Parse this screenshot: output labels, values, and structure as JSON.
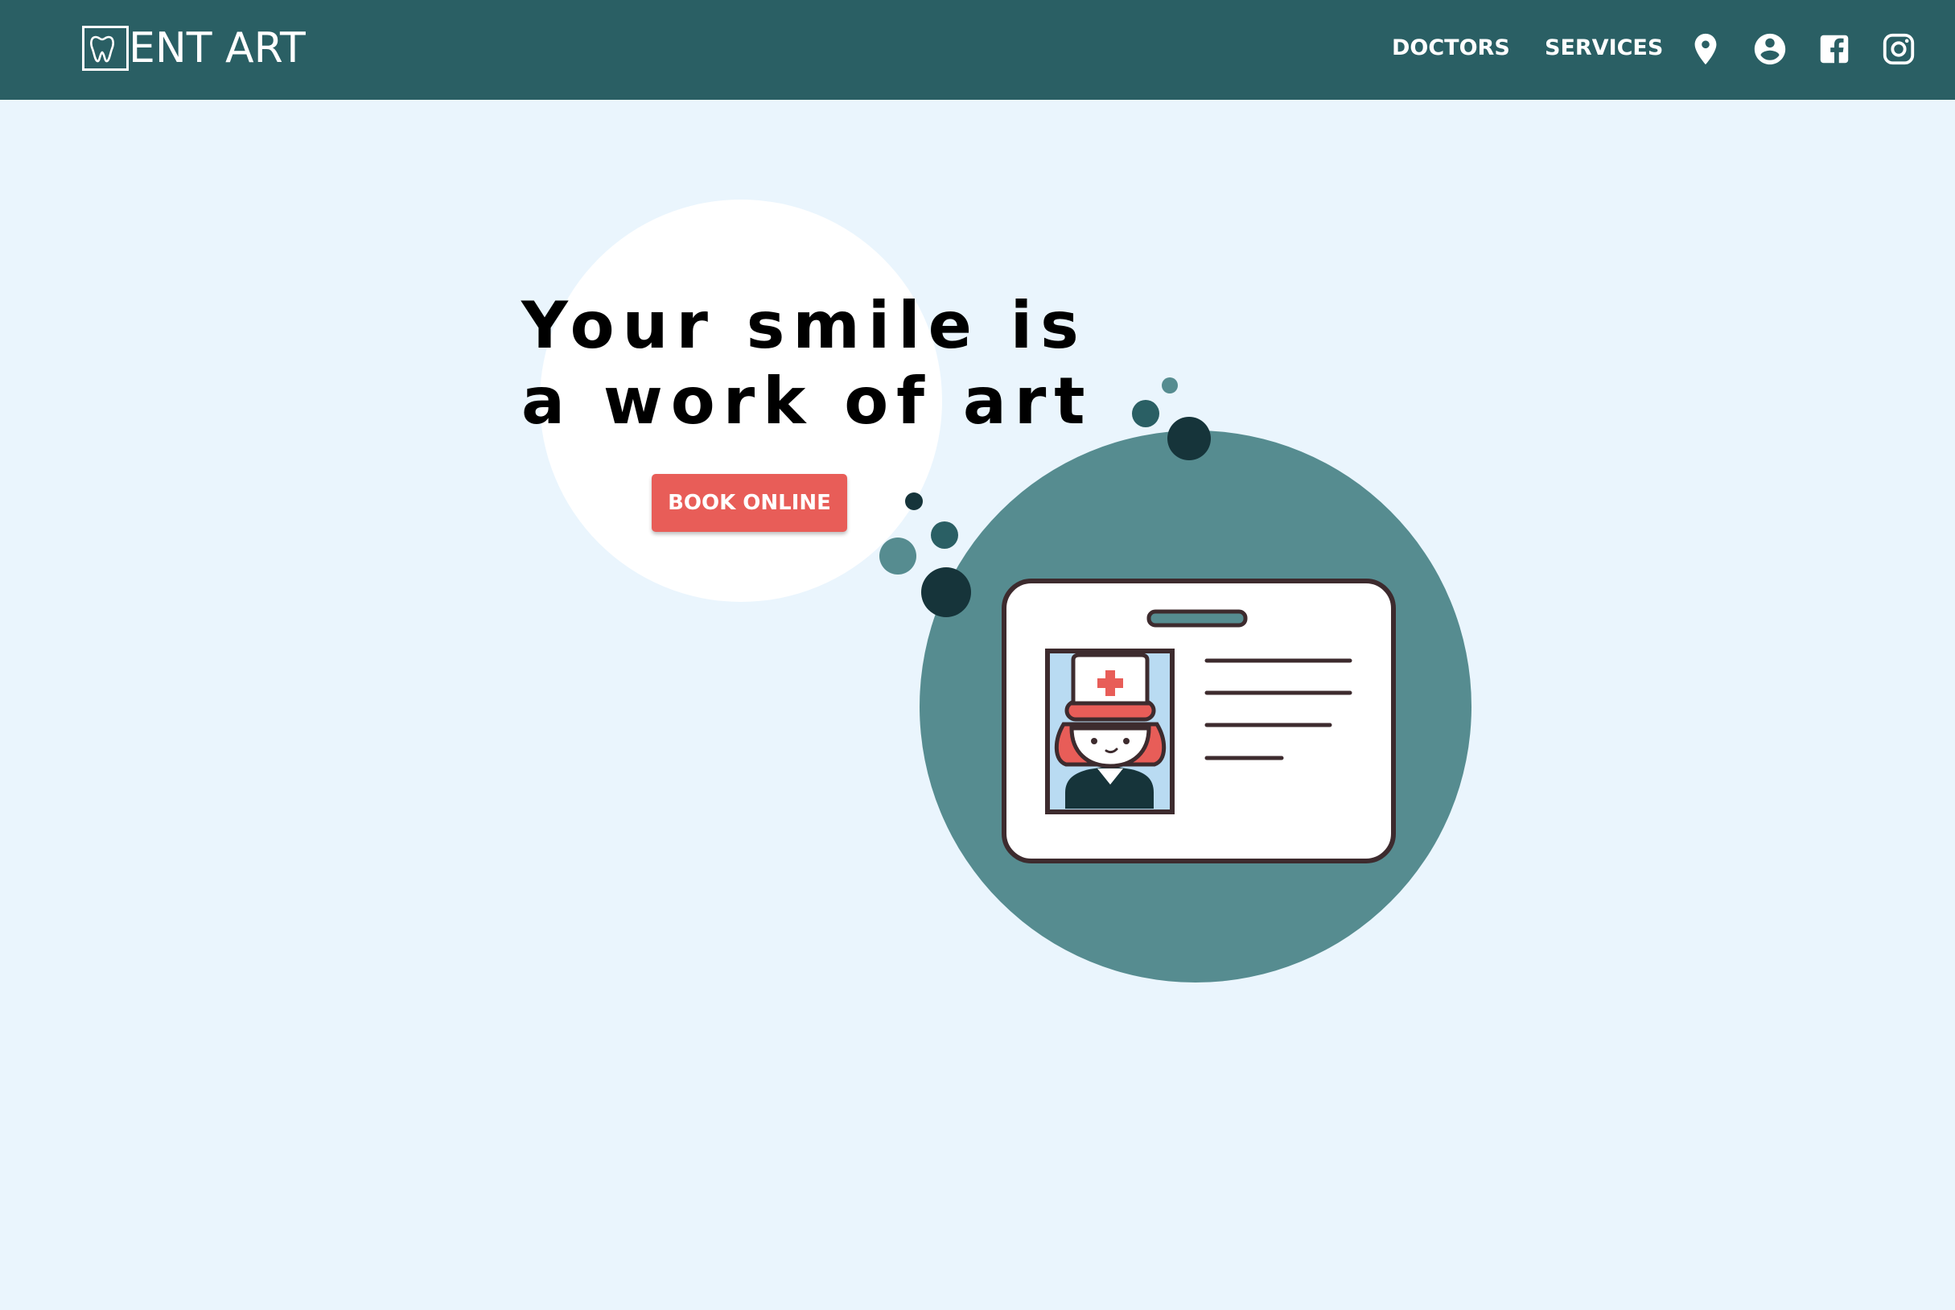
{
  "header": {
    "brand": "ENT ART",
    "nav": [
      "DOCTORS",
      "SERVICES"
    ],
    "icons": [
      "location-pin-icon",
      "account-circle-icon",
      "facebook-icon",
      "instagram-icon"
    ]
  },
  "hero": {
    "title_line1": "Your smile is",
    "title_line2": "a work of art",
    "cta": "BOOK ONLINE"
  },
  "colors": {
    "navbar": "#2a5f64",
    "background": "#eaf5fd",
    "accent": "#e85d58",
    "teal_circle": "#568c90",
    "dark_dot": "#16343a"
  }
}
